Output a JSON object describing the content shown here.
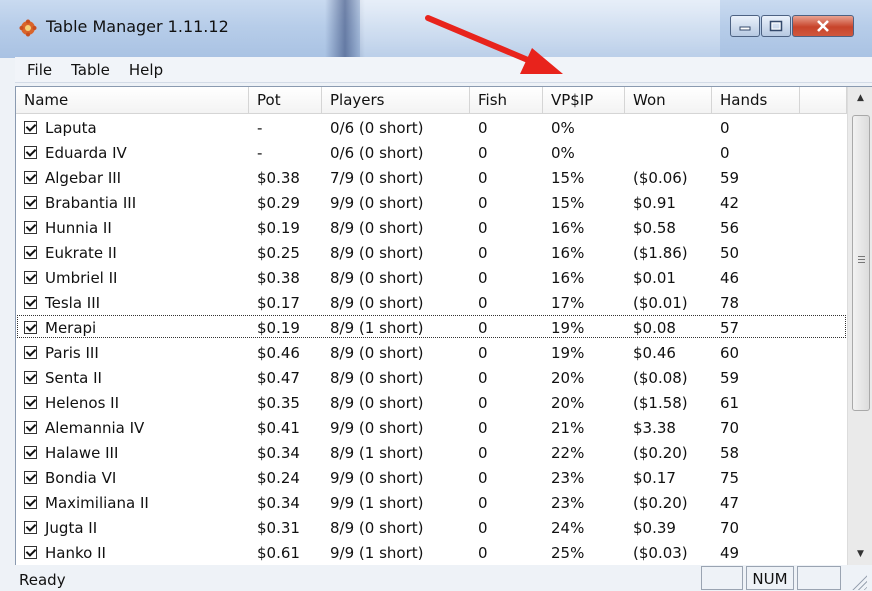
{
  "window": {
    "title": "Table Manager 1.11.12"
  },
  "menu": [
    "File",
    "Table",
    "Help"
  ],
  "columns": [
    "Name",
    "Pot",
    "Players",
    "Fish",
    "VP$IP",
    "Won",
    "Hands",
    ""
  ],
  "rows": [
    {
      "name": "Laputa",
      "pot": "-",
      "players": "0/6 (0 short)",
      "fish": "0",
      "vpip": "0%",
      "won": "",
      "hands": "0"
    },
    {
      "name": "Eduarda IV",
      "pot": "-",
      "players": "0/6 (0 short)",
      "fish": "0",
      "vpip": "0%",
      "won": "",
      "hands": "0"
    },
    {
      "name": "Algebar III",
      "pot": "$0.38",
      "players": "7/9 (0 short)",
      "fish": "0",
      "vpip": "15%",
      "won": "($0.06)",
      "hands": "59"
    },
    {
      "name": "Brabantia III",
      "pot": "$0.29",
      "players": "9/9 (0 short)",
      "fish": "0",
      "vpip": "15%",
      "won": "$0.91",
      "hands": "42"
    },
    {
      "name": "Hunnia II",
      "pot": "$0.19",
      "players": "8/9 (0 short)",
      "fish": "0",
      "vpip": "16%",
      "won": "$0.58",
      "hands": "56"
    },
    {
      "name": "Eukrate II",
      "pot": "$0.25",
      "players": "8/9 (0 short)",
      "fish": "0",
      "vpip": "16%",
      "won": "($1.86)",
      "hands": "50"
    },
    {
      "name": "Umbriel II",
      "pot": "$0.38",
      "players": "8/9 (0 short)",
      "fish": "0",
      "vpip": "16%",
      "won": "$0.01",
      "hands": "46"
    },
    {
      "name": "Tesla III",
      "pot": "$0.17",
      "players": "8/9 (0 short)",
      "fish": "0",
      "vpip": "17%",
      "won": "($0.01)",
      "hands": "78"
    },
    {
      "name": "Merapi",
      "pot": "$0.19",
      "players": "8/9 (1 short)",
      "fish": "0",
      "vpip": "19%",
      "won": "$0.08",
      "hands": "57"
    },
    {
      "name": "Paris III",
      "pot": "$0.46",
      "players": "8/9 (0 short)",
      "fish": "0",
      "vpip": "19%",
      "won": "$0.46",
      "hands": "60"
    },
    {
      "name": "Senta II",
      "pot": "$0.47",
      "players": "8/9 (0 short)",
      "fish": "0",
      "vpip": "20%",
      "won": "($0.08)",
      "hands": "59"
    },
    {
      "name": "Helenos II",
      "pot": "$0.35",
      "players": "8/9 (0 short)",
      "fish": "0",
      "vpip": "20%",
      "won": "($1.58)",
      "hands": "61"
    },
    {
      "name": "Alemannia IV",
      "pot": "$0.41",
      "players": "9/9 (0 short)",
      "fish": "0",
      "vpip": "21%",
      "won": "$3.38",
      "hands": "70"
    },
    {
      "name": "Halawe III",
      "pot": "$0.34",
      "players": "8/9 (1 short)",
      "fish": "0",
      "vpip": "22%",
      "won": "($0.20)",
      "hands": "58"
    },
    {
      "name": "Bondia VI",
      "pot": "$0.24",
      "players": "9/9 (0 short)",
      "fish": "0",
      "vpip": "23%",
      "won": "$0.17",
      "hands": "75"
    },
    {
      "name": "Maximiliana II",
      "pot": "$0.34",
      "players": "9/9 (1 short)",
      "fish": "0",
      "vpip": "23%",
      "won": "($0.20)",
      "hands": "47"
    },
    {
      "name": "Jugta II",
      "pot": "$0.31",
      "players": "8/9 (0 short)",
      "fish": "0",
      "vpip": "24%",
      "won": "$0.39",
      "hands": "70"
    },
    {
      "name": "Hanko II",
      "pot": "$0.61",
      "players": "9/9 (1 short)",
      "fish": "0",
      "vpip": "25%",
      "won": "($0.03)",
      "hands": "49"
    }
  ],
  "focused_row": "Merapi",
  "status": {
    "text": "Ready",
    "num": "NUM"
  },
  "colors": {
    "annotation_arrow": "#e8231c",
    "close_button": "#c7442b"
  }
}
